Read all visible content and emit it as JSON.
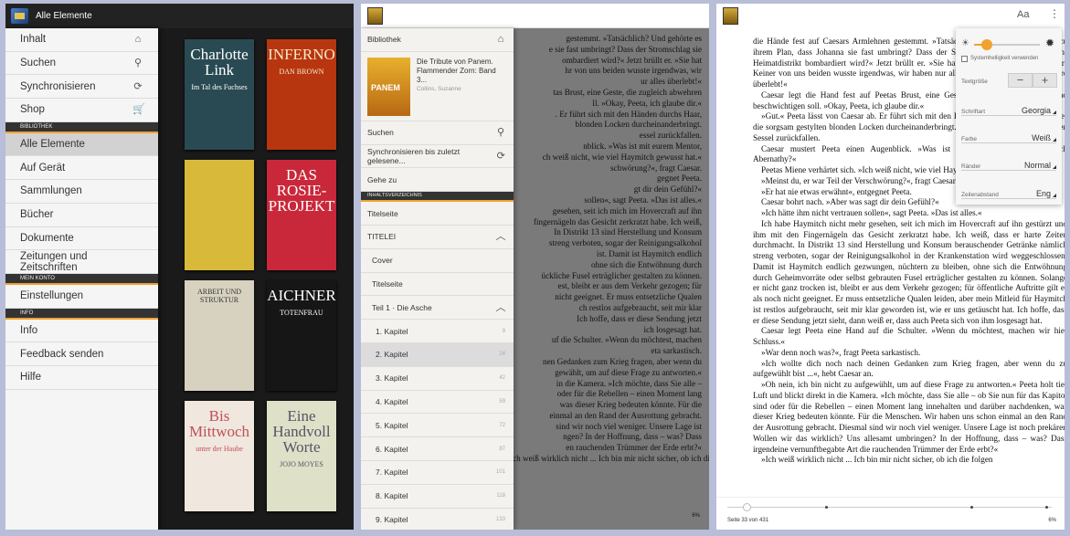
{
  "library": {
    "title": "Alle Elemente",
    "drawer": [
      {
        "label": "Inhalt",
        "icon": "home-icon"
      },
      {
        "label": "Suchen",
        "icon": "search-icon"
      },
      {
        "label": "Synchronisieren",
        "icon": "sync-icon"
      },
      {
        "label": "Shop",
        "icon": "cart-icon"
      }
    ],
    "section_bibliothek": "BIBLIOTHEK",
    "library_items": [
      "Alle Elemente",
      "Auf Gerät",
      "Sammlungen",
      "Bücher",
      "Dokumente",
      "Zeitungen und Zeitschriften"
    ],
    "section_konto": "MEIN KONTO",
    "account_items": [
      "Einstellungen"
    ],
    "section_info": "INFO",
    "info_items": [
      "Info",
      "Feedback senden",
      "Hilfe"
    ],
    "books": [
      {
        "t1": "Charlotte Link",
        "t2": "Im Tal des Fuchses",
        "bg": "#2a4a53",
        "fg": "#ffffff"
      },
      {
        "t1": "INFERNO",
        "t2": "DAN BROWN",
        "bg": "#b8360f",
        "fg": "#f6e9c9"
      },
      {
        "t1": "",
        "t2": "",
        "bg": "#d9b93a",
        "fg": "#333"
      },
      {
        "t1": "DAS ROSIE-PROJEKT",
        "t2": "",
        "bg": "#c9283a",
        "fg": "#ffffff"
      },
      {
        "t1": "",
        "t2": "ARBEIT UND STRUKTUR",
        "bg": "#d7d1c0",
        "fg": "#333"
      },
      {
        "t1": "AICHNER",
        "t2": "TOTENFRAU",
        "bg": "#161616",
        "fg": "#ffffff"
      },
      {
        "t1": "Bis Mittwoch",
        "t2": "unter der Haube",
        "bg": "#f0e7de",
        "fg": "#c0505a"
      },
      {
        "t1": "Eine Handvoll Worte",
        "t2": "JOJO MOYES",
        "bg": "#dfe0c8",
        "fg": "#556"
      }
    ]
  },
  "toc": {
    "library_label": "Bibliothek",
    "book_title": "Die Tribute von Panem. Flammender Zorn: Band 3...",
    "book_author": "Collins, Suzanne",
    "cover_text": "PANEM",
    "search_label": "Suchen",
    "sync_label": "Synchronisieren bis zuletzt gelesene...",
    "goto_label": "Gehe zu",
    "section_label": "INHALTSVERZEICHNIS",
    "titlepage": "Titelseite",
    "titelei": "TITELEI",
    "cover": "Cover",
    "titelseite": "Titelseite",
    "part": "Teil 1 · Die Asche",
    "chapters": [
      {
        "label": "1. Kapitel",
        "page": "9"
      },
      {
        "label": "2. Kapitel",
        "page": "24"
      },
      {
        "label": "3. Kapitel",
        "page": "42"
      },
      {
        "label": "4. Kapitel",
        "page": "59"
      },
      {
        "label": "5. Kapitel",
        "page": "72"
      },
      {
        "label": "6. Kapitel",
        "page": "87"
      },
      {
        "label": "7. Kapitel",
        "page": "101"
      },
      {
        "label": "8. Kapitel",
        "page": "118"
      },
      {
        "label": "9. Kapitel",
        "page": "133"
      }
    ],
    "bg_lines": [
      "gestemmt. »Tatsächlich? Und gehörte es",
      "e sie fast umbringt? Dass der Stromschlag sie",
      "ombardiert wird?« Jetzt brüllt er. »Sie hat",
      "hr von uns beiden wusste irgendwas, wir",
      "ur alles überlebt!«",
      "tas Brust, eine Geste, die zugleich abwehren",
      "ll. »Okay, Peeta, ich glaube dir.«",
      ". Er führt sich mit den Händen durchs Haar,",
      "blonden Locken durcheinanderbringt.",
      "essel zurückfallen.",
      "nblick. »Was ist mit eurem Mentor,",
      "",
      "ch weiß nicht, wie viel Haymitch gewusst hat.«",
      "schwörung?«, fragt Caesar.",
      "gegnet Peeta.",
      "gt dir dein Gefühl?«",
      "sollen«, sagt Peeta. »Das ist alles.«",
      "gesehen, seit ich mich im Hovercraft auf ihn",
      "fingernägeln das Gesicht zerkratzt habe. Ich weiß,",
      "In Distrikt 13 sind Herstellung und Konsum",
      "streng verboten, sogar der Reinigungsalkohol",
      "ist. Damit ist Haymitch endlich",
      "ohne sich die Entwöhnung durch",
      "ückliche Fusel erträglicher gestalten zu können.",
      "est, bleibt er aus dem Verkehr gezogen; für",
      "nicht geeignet. Er muss entsetzliche Qualen",
      "ch restlos aufgebraucht, seit mir klar",
      "Ich hoffe, dass er diese Sendung jetzt",
      "ich losgesagt hat.",
      "uf die Schulter. »Wenn du möchtest, machen",
      "",
      "eta sarkastisch.",
      "nen Gedanken zum Krieg fragen, aber wenn du",
      "",
      "gewählt, um auf diese Frage zu antworten.«",
      "in die Kamera. »Ich möchte, dass Sie alle –",
      "oder für die Rebellen – einen Moment lang",
      "was dieser Krieg bedeuten könnte. Für die",
      "einmal an den Rand der Ausrottung gebracht.",
      "sind wir noch viel weniger. Unsere Lage ist",
      "ngen? In der Hoffnung, dass – was? Dass",
      "en rauchenden Trümmer der Erde erbt?«",
      "ch weiß wirklich nicht ... Ich bin mir nicht sicher, ob ich die folgen"
    ],
    "bg_progress": "6%"
  },
  "reader": {
    "font_button": "Aa",
    "settings": {
      "system_brightness": "Systemhelligkeit verwenden",
      "textsize_label": "Textgröße",
      "font_label": "Schriftart",
      "font_value": "Georgia",
      "color_label": "Farbe",
      "color_value": "Weiß",
      "margin_label": "Ränder",
      "margin_value": "Normal",
      "spacing_label": "Zeilenabstand",
      "spacing_value": "Eng",
      "brightness": 0.2,
      "accent": "#f0a12f"
    },
    "paragraphs": [
      {
        "ni": true,
        "text": "die Hände fest auf Caesars Armlehnen gestemmt. »Tatsächlich? Und gehörte es auch zu ihrem Plan, dass Johanna sie fast umbringt? Dass der Stromschlag sie lähmt? Dass ihr Heimatdistrikt bombardiert wird?« Jetzt brüllt er. »Sie hat nichts davon gewusst, Caesar! Keiner von uns beiden wusste irgendwas, wir haben nur alles darum getan, dass der andere überlebt!«"
      },
      {
        "text": "Caesar legt die Hand fest auf Peetas Brust, eine Geste, die zugleich abwehren und beschwichtigen soll. »Okay, Peeta, ich glaube dir.«"
      },
      {
        "text": "»Gut.« Peeta lässt von Caesar ab. Er führt sich mit den Händen durchs Haar, wodurch er die sorgsam gestylten blonden Locken durcheinanderbringt. Aufgelöst lässt er sich in seinen Sessel zurückfallen."
      },
      {
        "text": "Caesar mustert Peeta einen Augenblick. »Was ist mit eurem Mentor, Haymitch Abernathy?«"
      },
      {
        "text": "Peetas Miene verhärtet sich. »Ich weiß nicht, wie viel Haymitch gewusst hat.«"
      },
      {
        "text": "»Meinst du, er war Teil der Verschwörung?«, fragt Caesar."
      },
      {
        "text": "»Er hat nie etwas erwähnt«, entgegnet Peeta."
      },
      {
        "text": "Caesar bohrt nach. »Aber was sagt dir dein Gefühl?«"
      },
      {
        "text": "»Ich hätte ihm nicht vertrauen sollen«, sagt Peeta. »Das ist alles.«"
      },
      {
        "text": "Ich habe Haymitch nicht mehr gesehen, seit ich mich im Hovercraft auf ihn gestürzt und ihm mit den Fingernägeln das Gesicht zerkratzt habe. Ich weiß, dass er harte Zeiten durchmacht. In Distrikt 13 sind Herstellung und Konsum berauschender Getränke nämlich streng verboten, sogar der Reinigungsalkohol in der Krankenstation wird weggeschlossen. Damit ist Haymitch endlich gezwungen, nüchtern zu bleiben, ohne sich die Entwöhnung durch Geheimvorräte oder selbst gebrauten Fusel erträglicher gestalten zu können. Solange er nicht ganz trocken ist, bleibt er aus dem Verkehr gezogen; für öffentliche Auftritte gilt er als noch nicht geeignet. Er muss entsetzliche Qualen leiden, aber mein Mitleid für Haymitch ist restlos aufgebraucht, seit mir klar geworden ist, wie er uns getäuscht hat. Ich hoffe, dass er diese Sendung jetzt sieht, dann weiß er, dass auch Peeta sich von ihm losgesagt hat."
      },
      {
        "text": "Caesar legt Peeta eine Hand auf die Schulter. »Wenn du möchtest, machen wir hier Schluss.«"
      },
      {
        "text": "»War denn noch was?«, fragt Peeta sarkastisch."
      },
      {
        "text": "»Ich wollte dich noch nach deinen Gedanken zum Krieg fragen, aber wenn du zu aufgewühlt bist ...«, hebt Caesar an."
      },
      {
        "text": "»Oh nein, ich bin nicht zu aufgewühlt, um auf diese Frage zu antworten.« Peeta holt tief Luft und blickt direkt in die Kamera. »Ich möchte, dass Sie alle – ob Sie nun für das Kapitol sind oder für die Rebellen – einen Moment lang innehalten und darüber nachdenken, was dieser Krieg bedeuten könnte. Für die Menschen. Wir haben uns schon einmal an den Rand der Ausrottung gebracht. Diesmal sind wir noch viel weniger. Unsere Lage ist noch prekärer. Wollen wir das wirklich? Uns allesamt umbringen? In der Hoffnung, dass – was? Dass irgendeine vernunftbegabte Art die rauchenden Trümmer der Erde erbt?«"
      },
      {
        "text": "»Ich weiß wirklich nicht ... Ich bin mir nicht sicher, ob ich die folgen"
      }
    ],
    "page_label": "Seite 33 von 431",
    "progress_label": "6%",
    "progress": 0.06
  }
}
